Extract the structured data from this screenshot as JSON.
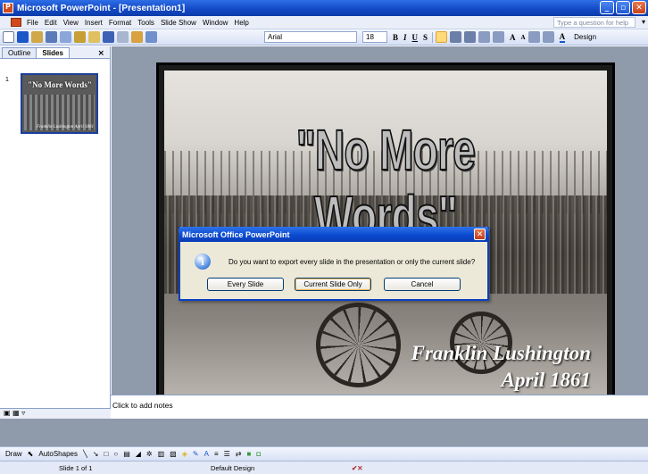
{
  "window": {
    "title": "Microsoft PowerPoint - [Presentation1]"
  },
  "menu": {
    "items": [
      "File",
      "Edit",
      "View",
      "Insert",
      "Format",
      "Tools",
      "Slide Show",
      "Window",
      "Help"
    ],
    "help_placeholder": "Type a question for help"
  },
  "toolbar": {
    "font_name": "Arial",
    "font_size": "18",
    "bold": "B",
    "italic": "I",
    "underline": "U",
    "shadow": "S",
    "design_label": "Design"
  },
  "left_pane": {
    "tabs": [
      "Outline",
      "Slides"
    ],
    "slide_number": "1",
    "thumb_title": "\"No More Words\"",
    "thumb_sub": "Franklin Lushington April 1861"
  },
  "slide": {
    "title": "\"No More Words\"",
    "author": "Franklin Lushington",
    "date": "April 1861"
  },
  "notes": {
    "placeholder": "Click to add notes"
  },
  "drawing": {
    "draw_label": "Draw",
    "autoshapes_label": "AutoShapes"
  },
  "status": {
    "slide_info": "Slide 1 of 1",
    "design": "Default Design"
  },
  "dialog": {
    "title": "Microsoft Office PowerPoint",
    "message": "Do you want to export every slide in the presentation or only the current slide?",
    "buttons": [
      "Every Slide",
      "Current Slide Only",
      "Cancel"
    ]
  }
}
